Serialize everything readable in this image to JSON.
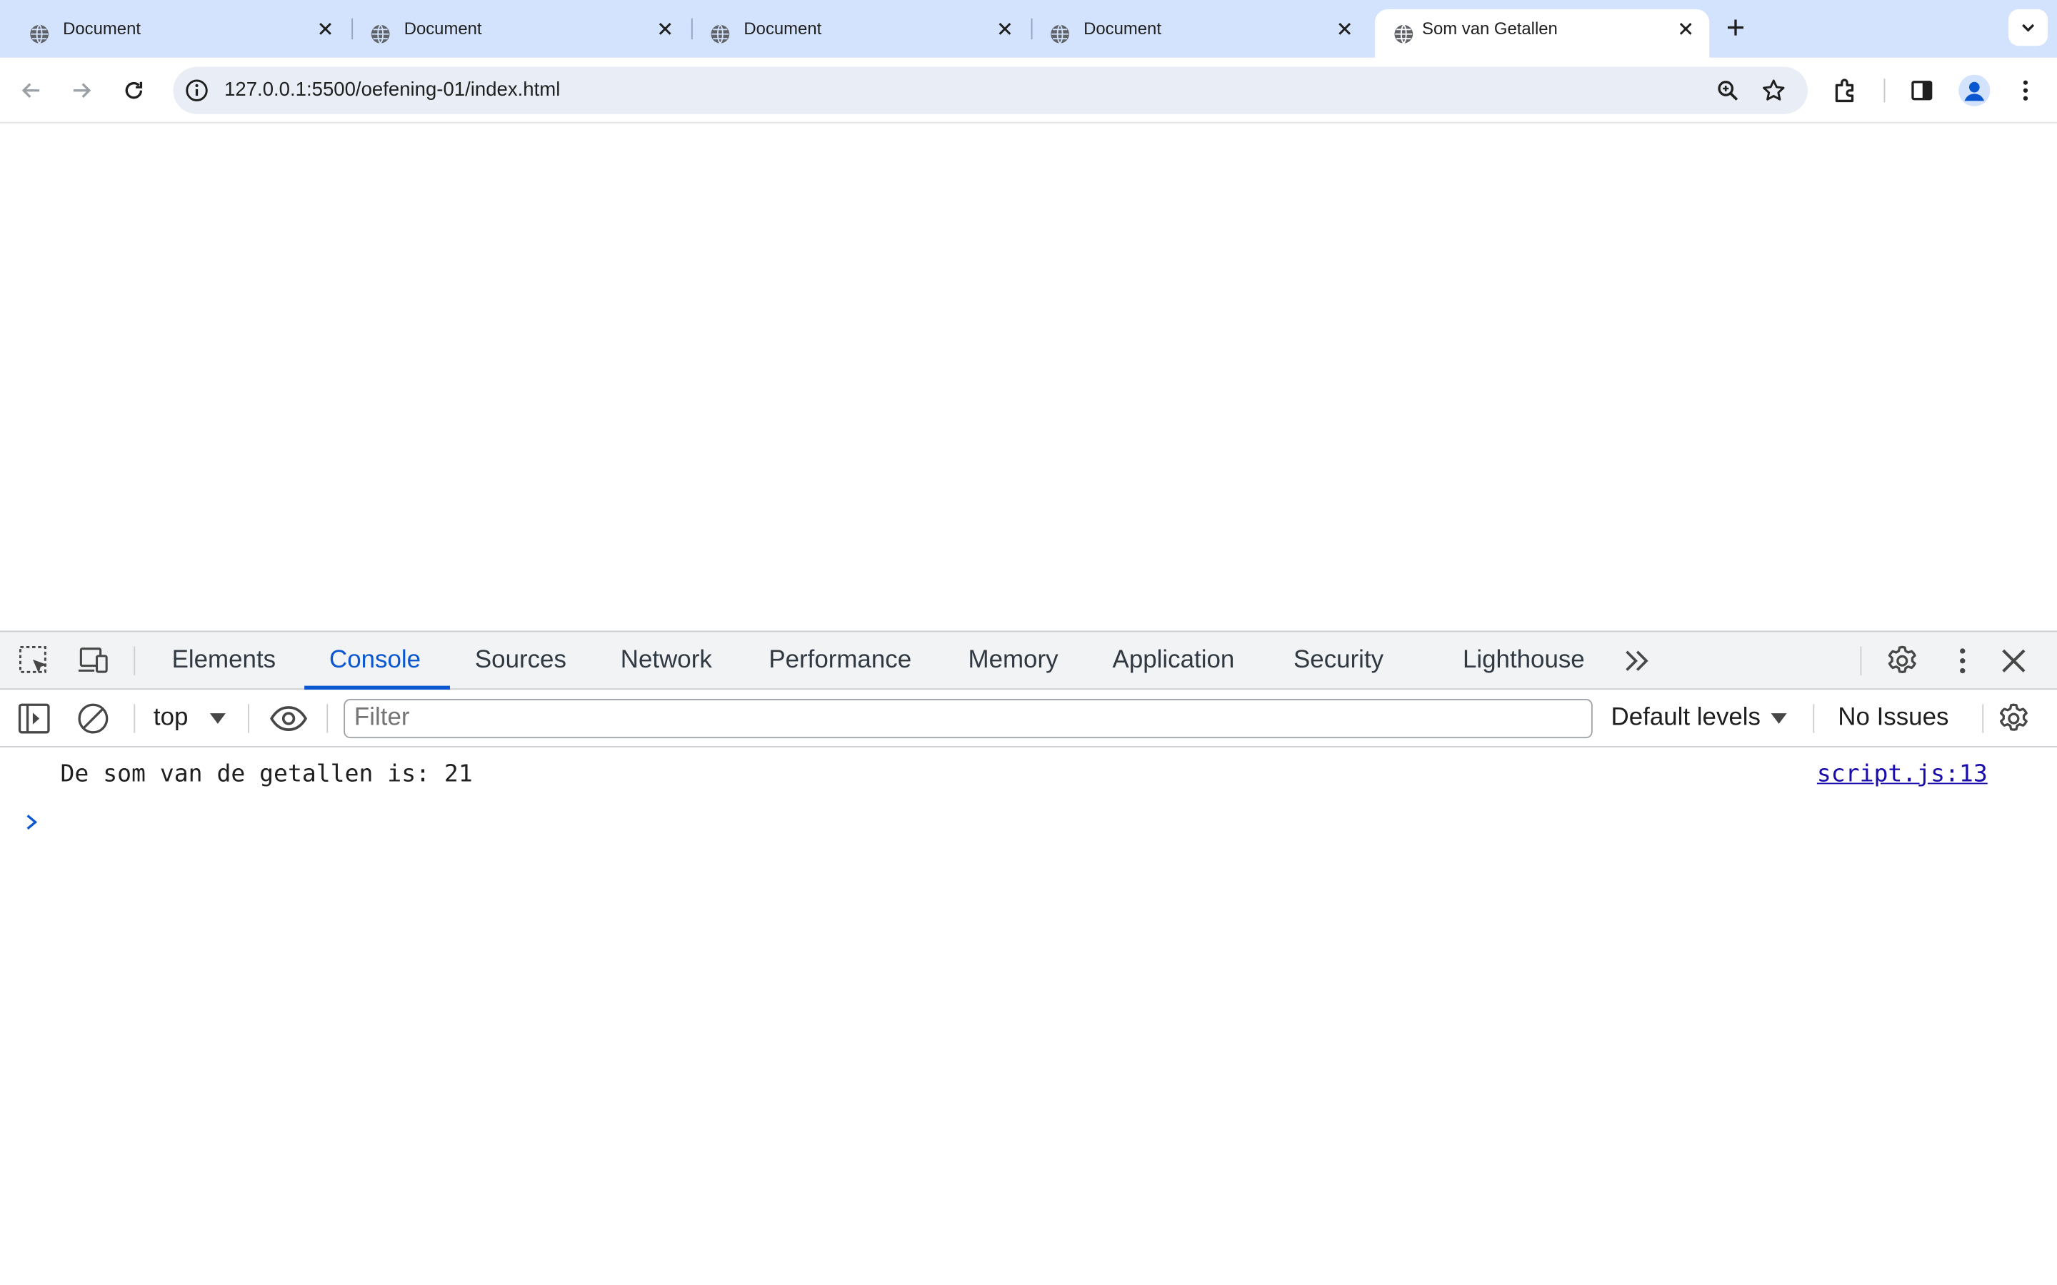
{
  "browser": {
    "tabs": [
      {
        "title": "Document",
        "active": false
      },
      {
        "title": "Document",
        "active": false
      },
      {
        "title": "Document",
        "active": false
      },
      {
        "title": "Document",
        "active": false
      },
      {
        "title": "Som van Getallen",
        "active": true
      }
    ],
    "address_bar": {
      "url": "127.0.0.1:5500/oefening-01/index.html"
    }
  },
  "devtools": {
    "tabs": [
      "Elements",
      "Console",
      "Sources",
      "Network",
      "Performance",
      "Memory",
      "Application",
      "Security",
      "Lighthouse"
    ],
    "active_tab": "Console",
    "console_toolbar": {
      "context": "top",
      "filter_placeholder": "Filter",
      "levels": "Default levels",
      "issues": "No Issues"
    },
    "console_messages": [
      {
        "text": "De som van de getallen is: 21",
        "source": "script.js:13"
      }
    ]
  },
  "colors": {
    "tabstrip_bg": "#d3e3fd",
    "accent": "#0b57d0",
    "omnibox_bg": "#e9eef6",
    "link": "#1a0dab"
  },
  "icons": [
    "globe-icon",
    "close-icon",
    "plus-icon",
    "chevron-down-icon",
    "back-arrow-icon",
    "forward-arrow-icon",
    "reload-icon",
    "site-info-icon",
    "zoom-icon",
    "star-icon",
    "extensions-icon",
    "side-panel-icon",
    "profile-icon",
    "kebab-menu-icon",
    "inspect-element-icon",
    "device-toolbar-icon",
    "more-tabs-icon",
    "settings-gear-icon",
    "sidebar-toggle-icon",
    "clear-console-icon",
    "dropdown-triangle-icon",
    "eye-icon",
    "console-prompt-icon"
  ]
}
